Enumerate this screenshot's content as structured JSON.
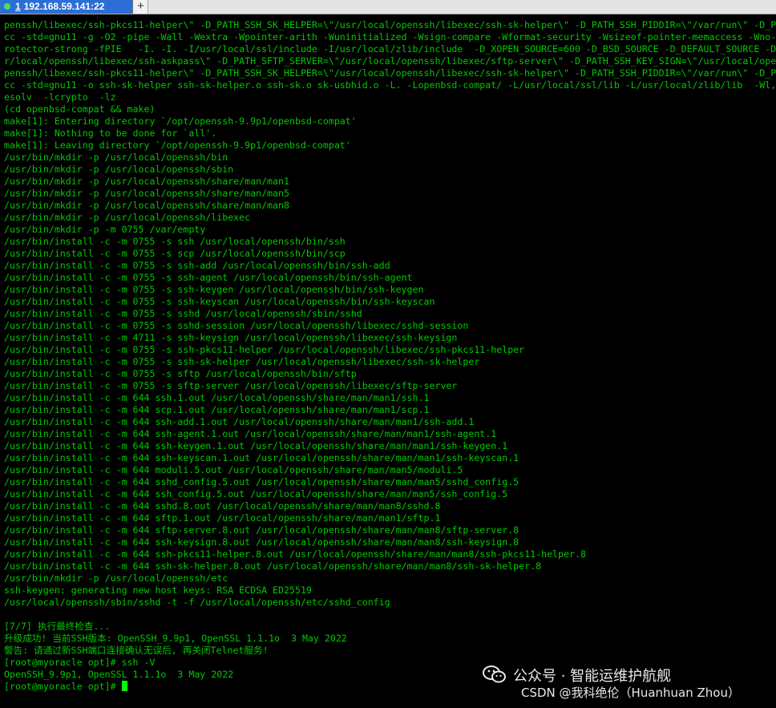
{
  "tab": {
    "number": "1",
    "title": "192.168.59.141:22"
  },
  "add_tab_label": "+",
  "lines": [
    "penssh/libexec/ssh-pkcs11-helper\\\" -D_PATH_SSH_SK_HELPER=\\\"/usr/local/openssh/libexec/ssh-sk-helper\\\" -D_PATH_SSH_PIDDIR=\\\"/var/run\\\" -D_P",
    "cc -std=gnu11 -g -O2 -pipe -Wall -Wextra -Wpointer-arith -Wuninitialized -Wsign-compare -Wformat-security -Wsizeof-pointer-memaccess -Wno-",
    "rotector-strong -fPIE   -I. -I. -I/usr/local/ssl/include -I/usr/local/zlib/include  -D_XOPEN_SOURCE=600 -D_BSD_SOURCE -D_DEFAULT_SOURCE -D",
    "r/local/openssh/libexec/ssh-askpass\\\" -D_PATH_SFTP_SERVER=\\\"/usr/local/openssh/libexec/sftp-server\\\" -D_PATH_SSH_KEY_SIGN=\\\"/usr/local/ope",
    "penssh/libexec/ssh-pkcs11-helper\\\" -D_PATH_SSH_SK_HELPER=\\\"/usr/local/openssh/libexec/ssh-sk-helper\\\" -D_PATH_SSH_PIDDIR=\\\"/var/run\\\" -D_P",
    "cc -std=gnu11 -o ssh-sk-helper ssh-sk-helper.o ssh-sk.o sk-usbhid.o -L. -Lopenbsd-compat/ -L/usr/local/ssl/lib -L/usr/local/zlib/lib  -Wl,",
    "esolv  -lcrypto  -lz",
    "(cd openbsd-compat && make)",
    "make[1]: Entering directory `/opt/openssh-9.9p1/openbsd-compat'",
    "make[1]: Nothing to be done for `all'.",
    "make[1]: Leaving directory `/opt/openssh-9.9p1/openbsd-compat'",
    "/usr/bin/mkdir -p /usr/local/openssh/bin",
    "/usr/bin/mkdir -p /usr/local/openssh/sbin",
    "/usr/bin/mkdir -p /usr/local/openssh/share/man/man1",
    "/usr/bin/mkdir -p /usr/local/openssh/share/man/man5",
    "/usr/bin/mkdir -p /usr/local/openssh/share/man/man8",
    "/usr/bin/mkdir -p /usr/local/openssh/libexec",
    "/usr/bin/mkdir -p -m 0755 /var/empty",
    "/usr/bin/install -c -m 0755 -s ssh /usr/local/openssh/bin/ssh",
    "/usr/bin/install -c -m 0755 -s scp /usr/local/openssh/bin/scp",
    "/usr/bin/install -c -m 0755 -s ssh-add /usr/local/openssh/bin/ssh-add",
    "/usr/bin/install -c -m 0755 -s ssh-agent /usr/local/openssh/bin/ssh-agent",
    "/usr/bin/install -c -m 0755 -s ssh-keygen /usr/local/openssh/bin/ssh-keygen",
    "/usr/bin/install -c -m 0755 -s ssh-keyscan /usr/local/openssh/bin/ssh-keyscan",
    "/usr/bin/install -c -m 0755 -s sshd /usr/local/openssh/sbin/sshd",
    "/usr/bin/install -c -m 0755 -s sshd-session /usr/local/openssh/libexec/sshd-session",
    "/usr/bin/install -c -m 4711 -s ssh-keysign /usr/local/openssh/libexec/ssh-keysign",
    "/usr/bin/install -c -m 0755 -s ssh-pkcs11-helper /usr/local/openssh/libexec/ssh-pkcs11-helper",
    "/usr/bin/install -c -m 0755 -s ssh-sk-helper /usr/local/openssh/libexec/ssh-sk-helper",
    "/usr/bin/install -c -m 0755 -s sftp /usr/local/openssh/bin/sftp",
    "/usr/bin/install -c -m 0755 -s sftp-server /usr/local/openssh/libexec/sftp-server",
    "/usr/bin/install -c -m 644 ssh.1.out /usr/local/openssh/share/man/man1/ssh.1",
    "/usr/bin/install -c -m 644 scp.1.out /usr/local/openssh/share/man/man1/scp.1",
    "/usr/bin/install -c -m 644 ssh-add.1.out /usr/local/openssh/share/man/man1/ssh-add.1",
    "/usr/bin/install -c -m 644 ssh-agent.1.out /usr/local/openssh/share/man/man1/ssh-agent.1",
    "/usr/bin/install -c -m 644 ssh-keygen.1.out /usr/local/openssh/share/man/man1/ssh-keygen.1",
    "/usr/bin/install -c -m 644 ssh-keyscan.1.out /usr/local/openssh/share/man/man1/ssh-keyscan.1",
    "/usr/bin/install -c -m 644 moduli.5.out /usr/local/openssh/share/man/man5/moduli.5",
    "/usr/bin/install -c -m 644 sshd_config.5.out /usr/local/openssh/share/man/man5/sshd_config.5",
    "/usr/bin/install -c -m 644 ssh_config.5.out /usr/local/openssh/share/man/man5/ssh_config.5",
    "/usr/bin/install -c -m 644 sshd.8.out /usr/local/openssh/share/man/man8/sshd.8",
    "/usr/bin/install -c -m 644 sftp.1.out /usr/local/openssh/share/man/man1/sftp.1",
    "/usr/bin/install -c -m 644 sftp-server.8.out /usr/local/openssh/share/man/man8/sftp-server.8",
    "/usr/bin/install -c -m 644 ssh-keysign.8.out /usr/local/openssh/share/man/man8/ssh-keysign.8",
    "/usr/bin/install -c -m 644 ssh-pkcs11-helper.8.out /usr/local/openssh/share/man/man8/ssh-pkcs11-helper.8",
    "/usr/bin/install -c -m 644 ssh-sk-helper.8.out /usr/local/openssh/share/man/man8/ssh-sk-helper.8",
    "/usr/bin/mkdir -p /usr/local/openssh/etc",
    "ssh-keygen: generating new host keys: RSA ECDSA ED25519",
    "/usr/local/openssh/sbin/sshd -t -f /usr/local/openssh/etc/sshd_config",
    "",
    "[7/7] 执行最终检查...",
    "升级成功! 当前SSH版本: OpenSSH_9.9p1, OpenSSL 1.1.1o  3 May 2022",
    "警告: 请通过新SSH端口连接确认无误后, 再关闭Telnet服务!",
    "[root@myoracle opt]# ssh -V",
    "OpenSSH_9.9p1, OpenSSL 1.1.1o  3 May 2022",
    "[root@myoracle opt]# "
  ],
  "watermark": {
    "line1": "公众号 · 智能运维护航舰",
    "line2": "CSDN @我科绝伦（Huanhuan Zhou）"
  },
  "colors": {
    "terminal_bg": "#000000",
    "terminal_fg": "#00c800",
    "tab_active": "#2b6fd6",
    "cursor": "#00ff00"
  }
}
